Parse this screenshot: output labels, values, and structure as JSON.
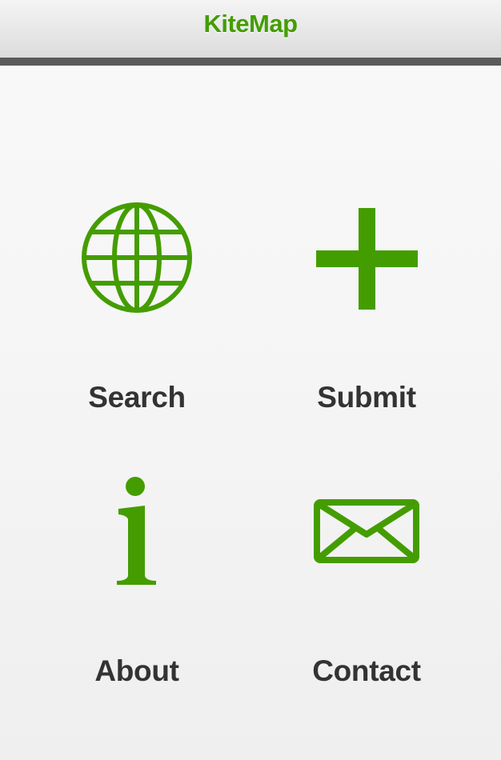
{
  "app": {
    "title": "KiteMap"
  },
  "colors": {
    "accent": "#449d00",
    "label": "#333333",
    "header_bar": "#5a5a5a"
  },
  "menu": {
    "items": [
      {
        "label": "Search",
        "icon": "globe-icon"
      },
      {
        "label": "Submit",
        "icon": "plus-icon"
      },
      {
        "label": "About",
        "icon": "info-icon"
      },
      {
        "label": "Contact",
        "icon": "envelope-icon"
      }
    ]
  }
}
